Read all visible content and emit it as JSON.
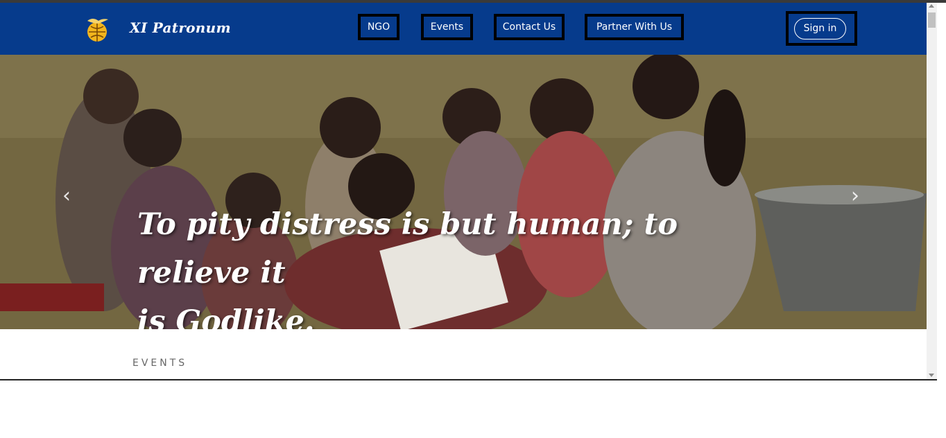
{
  "brand": {
    "name": "XI Patronum",
    "logo_icon": "globe-dove-icon"
  },
  "nav": {
    "items": [
      {
        "label": "NGO"
      },
      {
        "label": "Events"
      },
      {
        "label": "Contact Us"
      },
      {
        "label": "Partner With Us"
      }
    ],
    "signin_label": "Sign in"
  },
  "hero": {
    "caption_line1": "To pity distress is but human; to relieve it",
    "caption_line2": "is Godlike.",
    "prev_icon": "chevron-left-icon",
    "next_icon": "chevron-right-icon"
  },
  "section": {
    "label": "EVENTS"
  },
  "colors": {
    "navbar": "#063b8c",
    "button_border": "#000000",
    "text": "#ffffff"
  }
}
